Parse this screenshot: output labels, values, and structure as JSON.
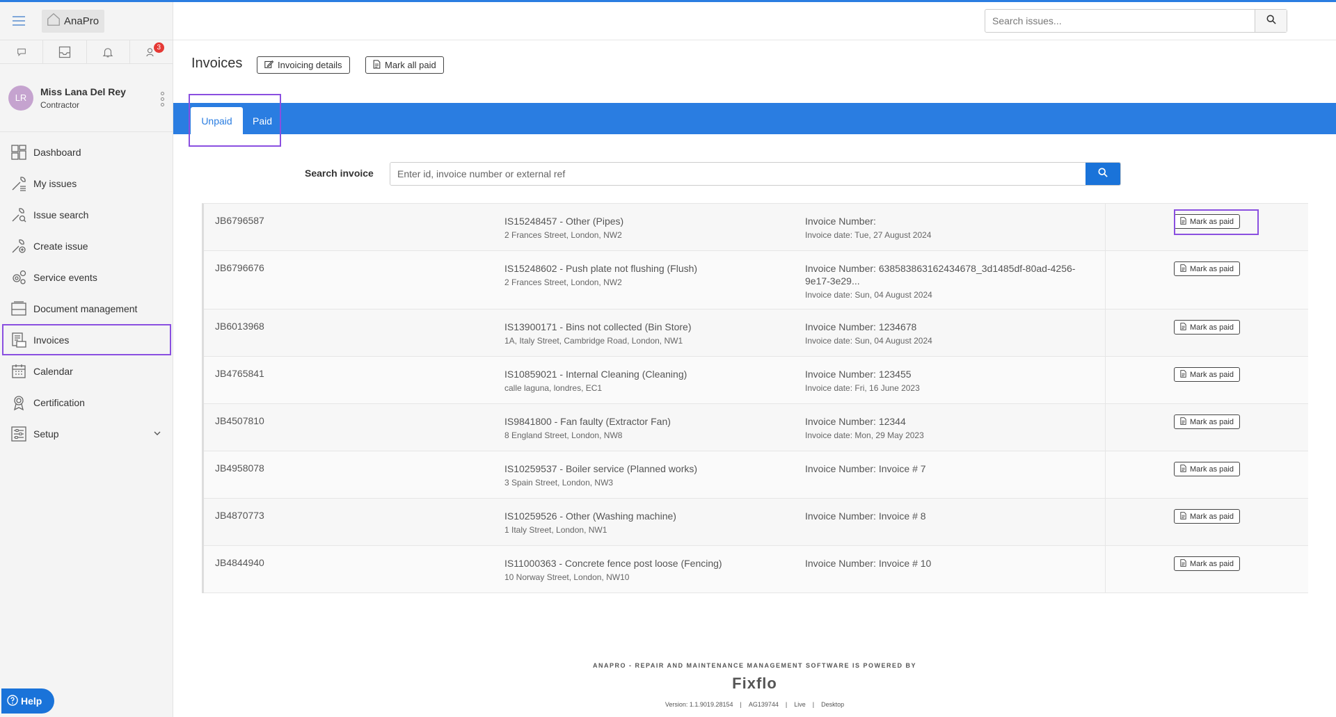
{
  "app": {
    "logo_text": "AnaPro"
  },
  "notifications": {
    "badge_count": "3"
  },
  "profile": {
    "initials": "LR",
    "name": "Miss Lana Del Rey",
    "role": "Contractor"
  },
  "nav": [
    {
      "label": "Dashboard",
      "icon": "dashboard-icon"
    },
    {
      "label": "My issues",
      "icon": "my-issues-icon"
    },
    {
      "label": "Issue search",
      "icon": "issue-search-icon"
    },
    {
      "label": "Create issue",
      "icon": "create-issue-icon"
    },
    {
      "label": "Service events",
      "icon": "service-events-icon"
    },
    {
      "label": "Document management",
      "icon": "document-management-icon"
    },
    {
      "label": "Invoices",
      "icon": "invoices-icon"
    },
    {
      "label": "Calendar",
      "icon": "calendar-icon"
    },
    {
      "label": "Certification",
      "icon": "certification-icon"
    },
    {
      "label": "Setup",
      "icon": "setup-icon"
    }
  ],
  "help_label": "Help",
  "header": {
    "search_placeholder": "Search issues..."
  },
  "page": {
    "title": "Invoices",
    "invoicing_details_label": "Invoicing details",
    "mark_all_paid_label": "Mark all paid"
  },
  "tabs": {
    "unpaid": "Unpaid",
    "paid": "Paid"
  },
  "search_invoice": {
    "label": "Search invoice",
    "placeholder": "Enter id, invoice number or external ref"
  },
  "invoices": [
    {
      "job": "JB6796587",
      "issue": "IS15248457 - Other (Pipes)",
      "address": "2 Frances Street, London, NW2",
      "invoice_number": "Invoice Number:",
      "invoice_date": "Invoice date: Tue, 27 August 2024",
      "action": "Mark as paid"
    },
    {
      "job": "JB6796676",
      "issue": "IS15248602 - Push plate not flushing (Flush)",
      "address": "2 Frances Street, London, NW2",
      "invoice_number": "Invoice Number: 638583863162434678_3d1485df-80ad-4256-9e17-3e29...",
      "invoice_date": "Invoice date: Sun, 04 August 2024",
      "action": "Mark as paid"
    },
    {
      "job": "JB6013968",
      "issue": "IS13900171 - Bins not collected (Bin Store)",
      "address": "1A, Italy Street, Cambridge Road, London, NW1",
      "invoice_number": "Invoice Number: 1234678",
      "invoice_date": "Invoice date: Sun, 04 August 2024",
      "action": "Mark as paid"
    },
    {
      "job": "JB4765841",
      "issue": "IS10859021 - Internal Cleaning (Cleaning)",
      "address": "calle laguna, londres, EC1",
      "invoice_number": "Invoice Number: 123455",
      "invoice_date": "Invoice date: Fri, 16 June 2023",
      "action": "Mark as paid"
    },
    {
      "job": "JB4507810",
      "issue": "IS9841800 - Fan faulty (Extractor Fan)",
      "address": "8 England Street, London, NW8",
      "invoice_number": "Invoice Number: 12344",
      "invoice_date": "Invoice date: Mon, 29 May 2023",
      "action": "Mark as paid"
    },
    {
      "job": "JB4958078",
      "issue": "IS10259537 - Boiler service (Planned works)",
      "address": "3 Spain Street, London, NW3",
      "invoice_number": "Invoice Number: Invoice # 7",
      "invoice_date": "",
      "action": "Mark as paid"
    },
    {
      "job": "JB4870773",
      "issue": "IS10259526 - Other (Washing machine)",
      "address": "1 Italy Street, London, NW1",
      "invoice_number": "Invoice Number: Invoice # 8",
      "invoice_date": "",
      "action": "Mark as paid"
    },
    {
      "job": "JB4844940",
      "issue": "IS11000363 - Concrete fence post loose (Fencing)",
      "address": "10 Norway Street, London, NW10",
      "invoice_number": "Invoice Number: Invoice # 10",
      "invoice_date": "",
      "action": "Mark as paid"
    }
  ],
  "footer": {
    "powered_by": "ANAPRO - REPAIR AND MAINTENANCE MANAGEMENT SOFTWARE IS POWERED BY",
    "brand": "Fixflo",
    "version": "Version: 1.1.9019.28154",
    "agency": "AG139744",
    "env": "Live",
    "mode": "Desktop"
  },
  "colors": {
    "accent": "#2a7de1",
    "highlight": "#8a4fe0",
    "badge": "#e53935"
  }
}
